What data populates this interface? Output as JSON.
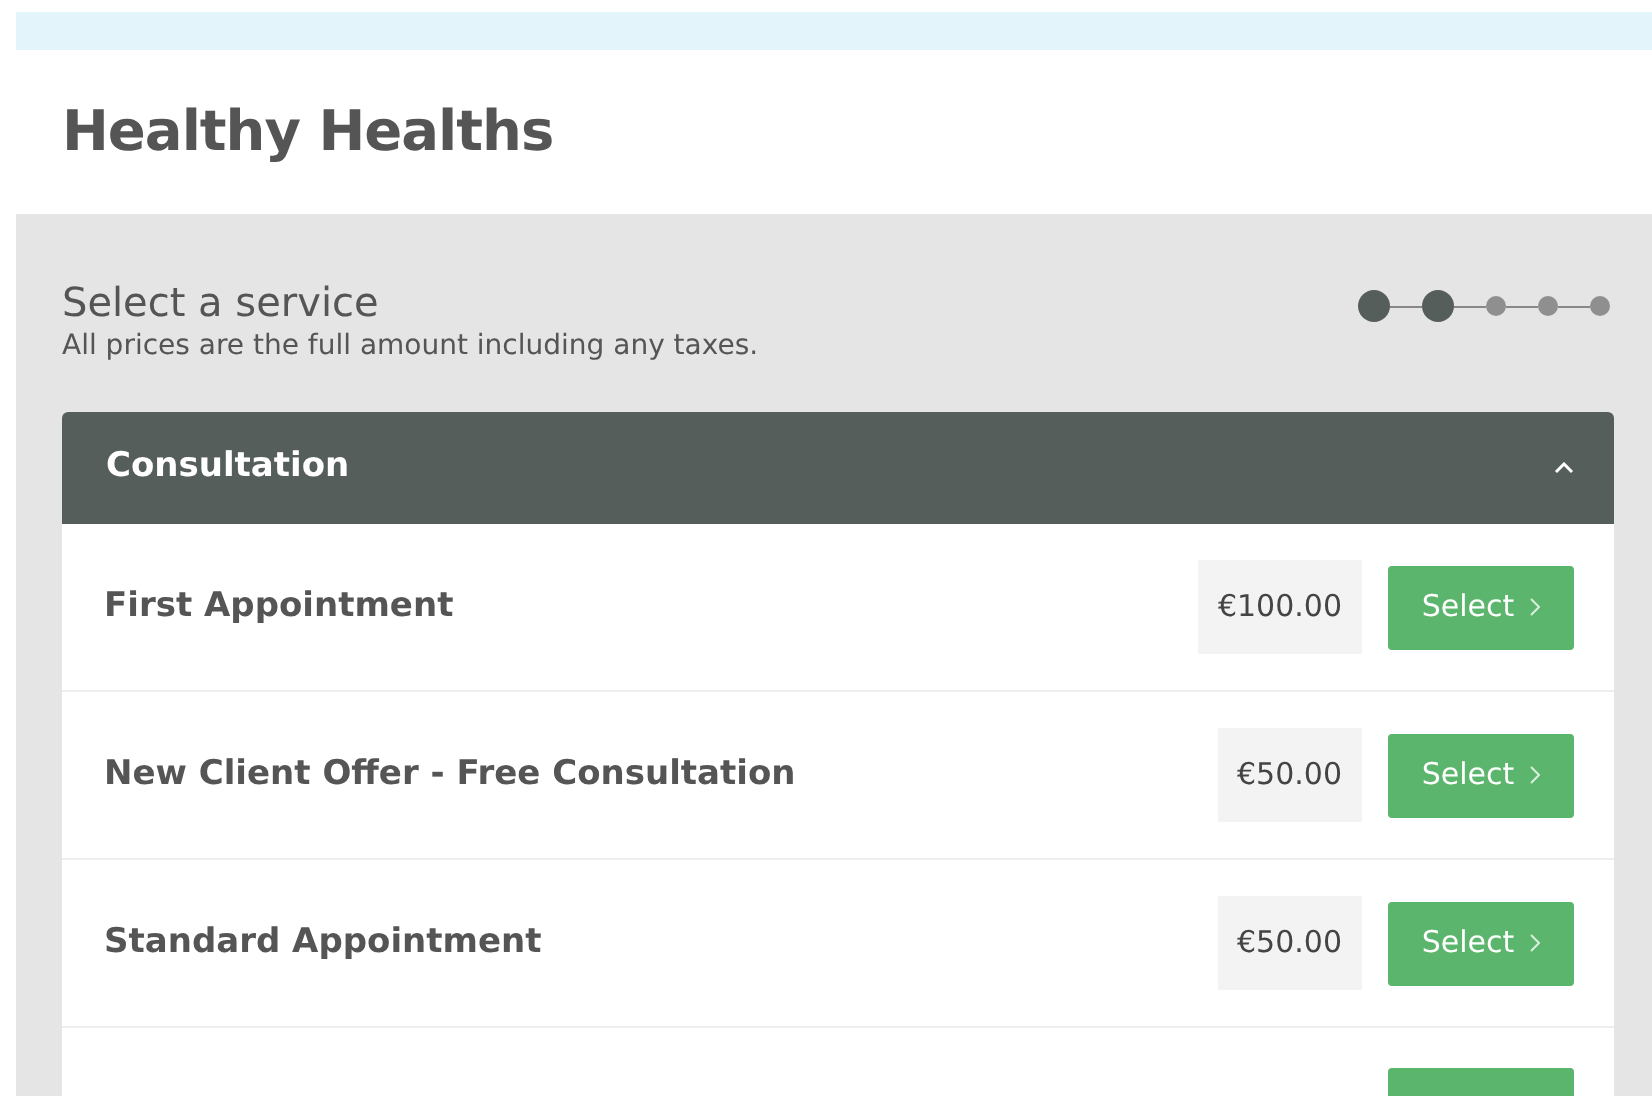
{
  "title": "Healthy Healths",
  "heading": "Select a service",
  "subtitle": "All prices are the full amount including any taxes.",
  "steps": [
    {
      "reached": true
    },
    {
      "reached": true
    },
    {
      "reached": false
    },
    {
      "reached": false
    },
    {
      "reached": false
    }
  ],
  "category": {
    "name": "Consultation",
    "expanded": true,
    "services": [
      {
        "name": "First Appointment",
        "price": "€100.00",
        "button": "Select"
      },
      {
        "name": "New Client Offer - Free Consultation",
        "price": "€50.00",
        "button": "Select"
      },
      {
        "name": "Standard Appointment",
        "price": "€50.00",
        "button": "Select"
      }
    ]
  }
}
